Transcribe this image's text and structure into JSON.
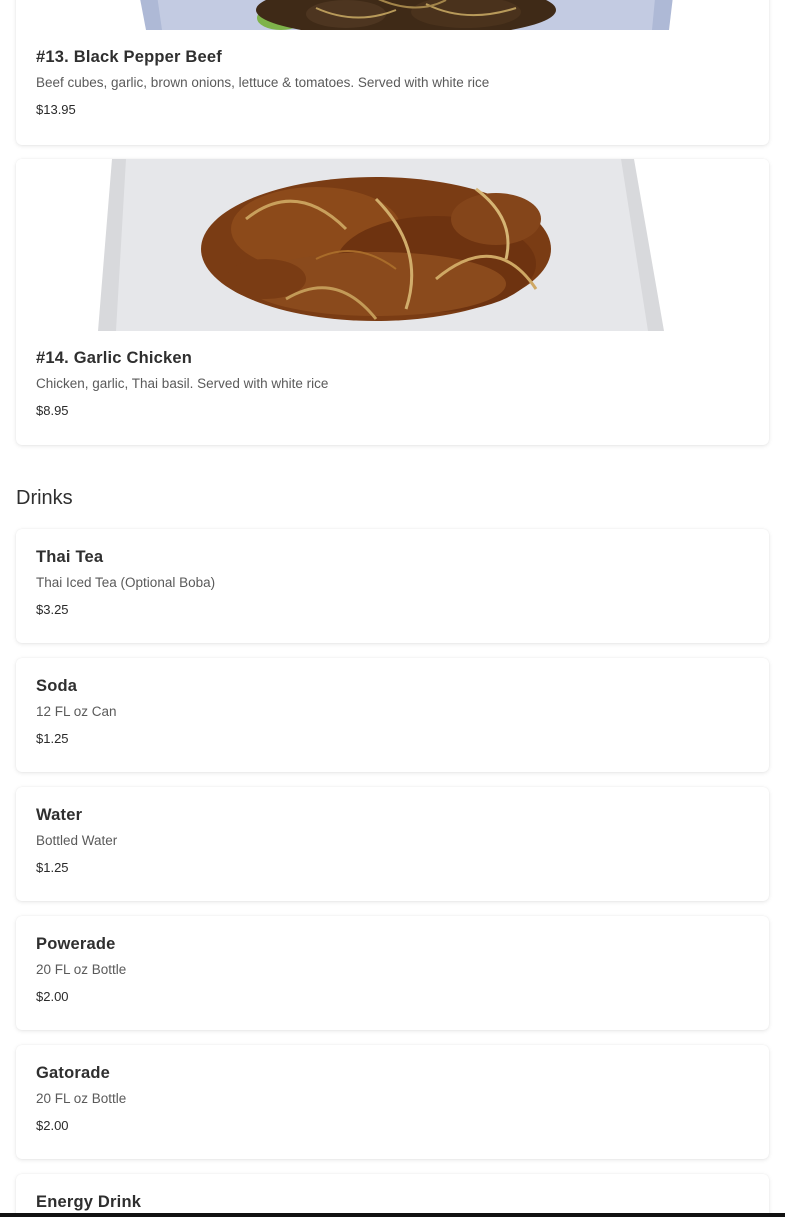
{
  "colors": {
    "background": "#ffffff",
    "card": "#ffffff",
    "text_primary": "#2f2f2f",
    "text_secondary": "#5a5a5a",
    "bottom_bar": "#111111"
  },
  "menu": {
    "items": [
      {
        "title": "#13. Black Pepper Beef",
        "description": "Beef cubes, garlic, brown onions, lettuce & tomatoes. Served with white rice",
        "price": "$13.95",
        "image": "black-pepper-beef-photo"
      },
      {
        "title": "#14. Garlic Chicken",
        "description": "Chicken, garlic, Thai basil. Served with white rice",
        "price": "$8.95",
        "image": "garlic-chicken-photo"
      }
    ]
  },
  "drinks": {
    "section_title": "Drinks",
    "items": [
      {
        "title": "Thai Tea",
        "description": "Thai Iced Tea (Optional Boba)",
        "price": "$3.25"
      },
      {
        "title": "Soda",
        "description": "12 FL oz Can",
        "price": "$1.25"
      },
      {
        "title": "Water",
        "description": "Bottled Water",
        "price": "$1.25"
      },
      {
        "title": "Powerade",
        "description": "20 FL oz Bottle",
        "price": "$2.00"
      },
      {
        "title": "Gatorade",
        "description": "20 FL oz Bottle",
        "price": "$2.00"
      },
      {
        "title": "Energy Drink"
      }
    ]
  }
}
